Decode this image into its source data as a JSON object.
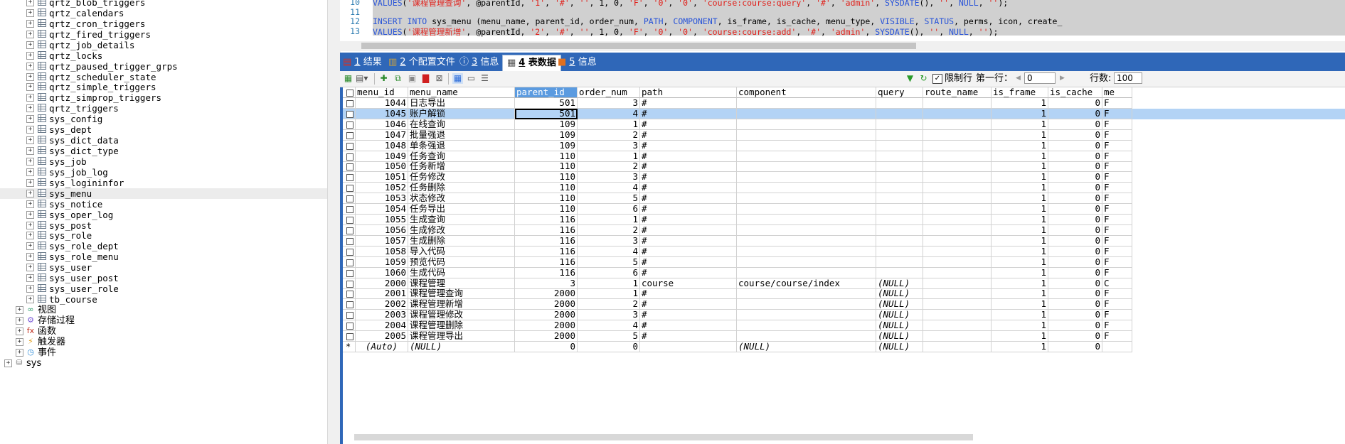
{
  "tree": {
    "tables": [
      "qrtz_blob_triggers",
      "qrtz_calendars",
      "qrtz_cron_triggers",
      "qrtz_fired_triggers",
      "qrtz_job_details",
      "qrtz_locks",
      "qrtz_paused_trigger_grps",
      "qrtz_scheduler_state",
      "qrtz_simple_triggers",
      "qrtz_simprop_triggers",
      "qrtz_triggers",
      "sys_config",
      "sys_dept",
      "sys_dict_data",
      "sys_dict_type",
      "sys_job",
      "sys_job_log",
      "sys_logininfor",
      "sys_menu",
      "sys_notice",
      "sys_oper_log",
      "sys_post",
      "sys_role",
      "sys_role_dept",
      "sys_role_menu",
      "sys_user",
      "sys_user_post",
      "sys_user_role",
      "tb_course"
    ],
    "selected_table": "sys_menu",
    "groups": [
      {
        "label": "视图",
        "icon": "view-icon"
      },
      {
        "label": "存储过程",
        "icon": "procedure-gear-icon"
      },
      {
        "label": "函数",
        "icon": "function-fx-icon"
      },
      {
        "label": "触发器",
        "icon": "trigger-bolt-icon"
      },
      {
        "label": "事件",
        "icon": "event-clock-icon"
      }
    ],
    "database": "sys"
  },
  "editor": {
    "lines": [
      {
        "num": "10",
        "text": "VALUES('课程管理查询', @parentId, '1', '#', '', 1, 0, 'F', '0', '0', 'course:course:query', '#', 'admin', SYSDATE(), '', NULL, '');"
      },
      {
        "num": "11",
        "text": ""
      },
      {
        "num": "12",
        "text": "INSERT INTO sys_menu (menu_name, parent_id, order_num, PATH, COMPONENT, is_frame, is_cache, menu_type, VISIBLE, STATUS, perms, icon, create_"
      },
      {
        "num": "13",
        "text": "VALUES('课程管理新增', @parentId, '2', '#', '', 1, 0, 'F', '0', '0', 'course:course:add', '#', 'admin', SYSDATE(), '', NULL, '');"
      }
    ]
  },
  "tabs": [
    {
      "num": "1",
      "label": "结果",
      "icon": "result-grid-icon"
    },
    {
      "num": "2",
      "label": "个配置文件",
      "icon": "profile-icon"
    },
    {
      "num": "3",
      "label": "信息",
      "icon": "info-icon"
    },
    {
      "num": "4",
      "label": "表数据",
      "icon": "table-data-icon",
      "active": true
    },
    {
      "num": "5",
      "label": "信息",
      "icon": "info-orange-icon"
    }
  ],
  "toolbar": {
    "limit_label": "限制行",
    "first_row_label": "第一行：",
    "first_row_value": "0",
    "row_count_label": "行数:",
    "row_count_value": "100"
  },
  "grid": {
    "columns": [
      "menu_id",
      "menu_name",
      "parent_id",
      "order_num",
      "path",
      "component",
      "query",
      "route_name",
      "is_frame",
      "is_cache",
      "me"
    ],
    "rows": [
      [
        "1044",
        "日志导出",
        "501",
        "3",
        "#",
        "",
        "",
        "",
        "1",
        "0",
        "F"
      ],
      [
        "1045",
        "账户解锁",
        "501",
        "4",
        "#",
        "",
        "",
        "",
        "1",
        "0",
        "F"
      ],
      [
        "1046",
        "在线查询",
        "109",
        "1",
        "#",
        "",
        "",
        "",
        "1",
        "0",
        "F"
      ],
      [
        "1047",
        "批量强退",
        "109",
        "2",
        "#",
        "",
        "",
        "",
        "1",
        "0",
        "F"
      ],
      [
        "1048",
        "单条强退",
        "109",
        "3",
        "#",
        "",
        "",
        "",
        "1",
        "0",
        "F"
      ],
      [
        "1049",
        "任务查询",
        "110",
        "1",
        "#",
        "",
        "",
        "",
        "1",
        "0",
        "F"
      ],
      [
        "1050",
        "任务新增",
        "110",
        "2",
        "#",
        "",
        "",
        "",
        "1",
        "0",
        "F"
      ],
      [
        "1051",
        "任务修改",
        "110",
        "3",
        "#",
        "",
        "",
        "",
        "1",
        "0",
        "F"
      ],
      [
        "1052",
        "任务删除",
        "110",
        "4",
        "#",
        "",
        "",
        "",
        "1",
        "0",
        "F"
      ],
      [
        "1053",
        "状态修改",
        "110",
        "5",
        "#",
        "",
        "",
        "",
        "1",
        "0",
        "F"
      ],
      [
        "1054",
        "任务导出",
        "110",
        "6",
        "#",
        "",
        "",
        "",
        "1",
        "0",
        "F"
      ],
      [
        "1055",
        "生成查询",
        "116",
        "1",
        "#",
        "",
        "",
        "",
        "1",
        "0",
        "F"
      ],
      [
        "1056",
        "生成修改",
        "116",
        "2",
        "#",
        "",
        "",
        "",
        "1",
        "0",
        "F"
      ],
      [
        "1057",
        "生成删除",
        "116",
        "3",
        "#",
        "",
        "",
        "",
        "1",
        "0",
        "F"
      ],
      [
        "1058",
        "导入代码",
        "116",
        "4",
        "#",
        "",
        "",
        "",
        "1",
        "0",
        "F"
      ],
      [
        "1059",
        "预览代码",
        "116",
        "5",
        "#",
        "",
        "",
        "",
        "1",
        "0",
        "F"
      ],
      [
        "1060",
        "生成代码",
        "116",
        "6",
        "#",
        "",
        "",
        "",
        "1",
        "0",
        "F"
      ],
      [
        "2000",
        "课程管理",
        "3",
        "1",
        "course",
        "course/course/index",
        "(NULL)",
        "",
        "1",
        "0",
        "C"
      ],
      [
        "2001",
        "课程管理查询",
        "2000",
        "1",
        "#",
        "",
        "(NULL)",
        "",
        "1",
        "0",
        "F"
      ],
      [
        "2002",
        "课程管理新增",
        "2000",
        "2",
        "#",
        "",
        "(NULL)",
        "",
        "1",
        "0",
        "F"
      ],
      [
        "2003",
        "课程管理修改",
        "2000",
        "3",
        "#",
        "",
        "(NULL)",
        "",
        "1",
        "0",
        "F"
      ],
      [
        "2004",
        "课程管理删除",
        "2000",
        "4",
        "#",
        "",
        "(NULL)",
        "",
        "1",
        "0",
        "F"
      ],
      [
        "2005",
        "课程管理导出",
        "2000",
        "5",
        "#",
        "",
        "(NULL)",
        "",
        "1",
        "0",
        "F"
      ]
    ],
    "new_row": [
      "(Auto)",
      "(NULL)",
      "0",
      "0",
      "",
      "(NULL)",
      "(NULL)",
      "",
      "1",
      "0",
      ""
    ],
    "new_row_marker": "*",
    "selected_row": 1,
    "selected_column": 2
  },
  "colors": {
    "tab_bar": "#2f67b8",
    "selection": "#b3d3f5",
    "header_selected": "#5b9be0"
  }
}
